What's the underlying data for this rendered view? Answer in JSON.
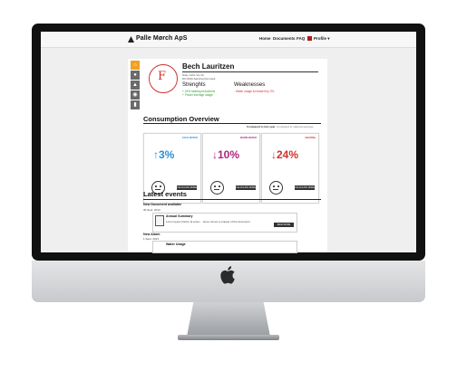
{
  "header": {
    "brand": "Palle Mørch ApS",
    "nav": [
      "Home",
      "Documents",
      "FAQ",
      "Profile ▾"
    ]
  },
  "profile": {
    "grade": "F",
    "name": "Bech Lauritzen",
    "address_line1": "Niels Juhls Vej 10",
    "address_line2": "DK-8230 Aabyhøj Denmark",
    "strengths_title": "Strenghts",
    "strengths": [
      "+ 24% heating reductions",
      "+ Power average usage"
    ],
    "weaknesses_title": "Weaknesses",
    "weaknesses": [
      "- Water usage increased by 3%"
    ]
  },
  "consumption": {
    "title": "Consumption Overview",
    "compare_active": "Compared to last year",
    "compare_other": "Compared to national average",
    "cards": [
      {
        "caption": "COLD WATER",
        "value": "↑3%",
        "color": "#2a8fd6",
        "button": "CALCULATE MORE"
      },
      {
        "caption": "WARM WATER",
        "value": "↓10%",
        "color": "#b0267e",
        "button": "CALCULATE MORE"
      },
      {
        "caption": "HEATING",
        "value": "↓24%",
        "color": "#d3302f",
        "button": "CALCULATE MORE"
      }
    ]
  },
  "events": {
    "title": "Latest events",
    "items": [
      {
        "type": "New Document available",
        "date": "30 Sept. 2013",
        "title": "Annual Summary",
        "text": "Lorem Ipsum Dolor sit amet.... Here comes a snippet of the document",
        "button": "READ MORE"
      },
      {
        "type": "New Alarm",
        "date": "1 Sept. 2013",
        "title": "Water Usage",
        "text": "",
        "button": ""
      }
    ]
  },
  "icons": {
    "sidebar": [
      "home-icon",
      "drop-icon",
      "flame-icon",
      "bulb-icon",
      "doc-icon"
    ]
  }
}
